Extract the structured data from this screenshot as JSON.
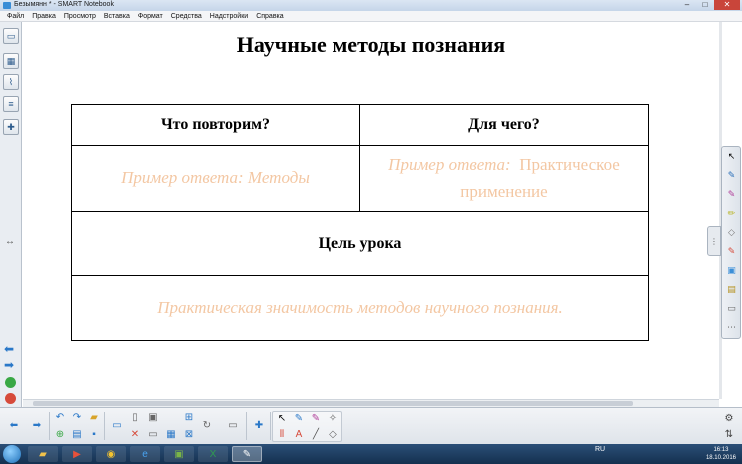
{
  "window": {
    "title": "Безымянн * - SMART Notebook",
    "minimize": "–",
    "maximize": "□",
    "close": "✕"
  },
  "menu": {
    "items": [
      "Файл",
      "Правка",
      "Просмотр",
      "Вставка",
      "Формат",
      "Средства",
      "Надстройки",
      "Справка"
    ]
  },
  "slide": {
    "title": "Научные методы познания",
    "table": {
      "header_left": "Что повторим?",
      "header_right": "Для чего?",
      "answer_left": "Пример ответа: Методы",
      "answer_right_italic": "Пример ответа:",
      "answer_right_upright": "Практическое применение",
      "goal_header": "Цель урока",
      "goal_answer": "Практическая значимость методов научного познания."
    }
  },
  "taskbar": {
    "language": "RU",
    "time": "16:13",
    "date": "18.10.2016"
  },
  "colors": {
    "answer_text": "#f3c7a3",
    "taskbar": "#1e3d60",
    "close_button": "#c9453a"
  }
}
